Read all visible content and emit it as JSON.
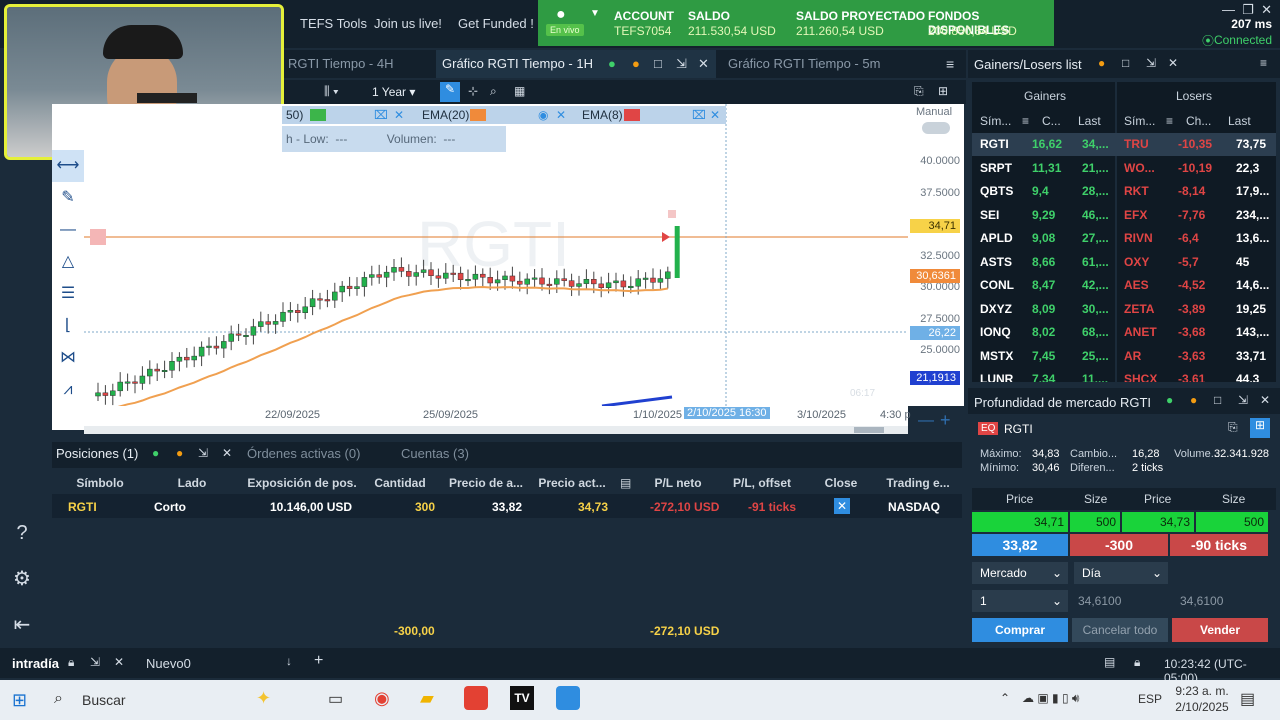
{
  "top_nav": {
    "links": [
      "TEFS Tools",
      "Join us live!",
      "Get Funded !"
    ]
  },
  "account": {
    "account_label": "ACCOUNT",
    "account_value": "TEFS7054",
    "live_badge": "En vivo",
    "saldo_label": "SALDO",
    "saldo_value": "211.530,54 USD",
    "proj_label": "SALDO PROYECTADO",
    "proj_value": "211.260,54 USD",
    "fondos_label": "FONDOS DISPONIBLES",
    "fondos_value": "200.850,54 USD"
  },
  "status": {
    "latency": "207 ms",
    "connection": "Connected"
  },
  "chart_tabs": [
    "RGTI Tiempo - 4H",
    "Gráfico RGTI Tiempo - 1H",
    "Gráfico RGTI Tiempo - 5m"
  ],
  "chart_toolbar": {
    "period": "1 Year"
  },
  "indicators": {
    "ind1": "50)",
    "ema20": "EMA(20)",
    "ema8": "EMA(8)"
  },
  "legend": {
    "low": "h - Low:",
    "low_val": "---",
    "vol": "Volumen:",
    "vol_val": "---"
  },
  "chart": {
    "symbol_watermark": "RGTI",
    "manual_label": "Manual",
    "price_labels": [
      "40.0000",
      "37.5000",
      "32.5000",
      "30.0000",
      "27.5000",
      "25.0000"
    ],
    "tag_last": "34,71",
    "tag_ema": "30,6361",
    "tag_cross": "26,22",
    "tag_low": "21,1913",
    "time_labels": [
      "22/09/2025",
      "25/09/2025",
      "1/10/2025",
      "2/10/2025 16:30",
      "3/10/2025",
      "4:30 p"
    ],
    "faint_time": "06:17"
  },
  "positions": {
    "tabs": [
      "Posiciones (1)",
      "Órdenes activas (0)",
      "Cuentas (3)"
    ],
    "headers": [
      "Símbolo",
      "Lado",
      "Exposición de pos.",
      "Cantidad",
      "Precio de a...",
      "Precio act...",
      "P/L neto",
      "P/L, offset",
      "Close",
      "Trading e..."
    ],
    "row": {
      "symbol": "RGTI",
      "side": "Corto",
      "exposure": "10.146,00 USD",
      "qty": "300",
      "entry": "33,82",
      "current": "34,73",
      "pl_net": "-272,10 USD",
      "pl_offset": "-91 ticks",
      "exchange": "NASDAQ"
    },
    "total_qty": "-300,00",
    "total_pl": "-272,10 USD"
  },
  "gainers_losers": {
    "title": "Gainers/Losers list",
    "gainers_title": "Gainers",
    "losers_title": "Losers",
    "col_sym": "Sím...",
    "col_ch_g": "C...",
    "col_ch_l": "Ch...",
    "col_last": "Last",
    "gainers": [
      {
        "sym": "RGTI",
        "ch": "16,62",
        "last": "34,..."
      },
      {
        "sym": "SRPT",
        "ch": "11,31",
        "last": "21,..."
      },
      {
        "sym": "QBTS",
        "ch": "9,4",
        "last": "28,..."
      },
      {
        "sym": "SEI",
        "ch": "9,29",
        "last": "46,..."
      },
      {
        "sym": "APLD",
        "ch": "9,08",
        "last": "27,..."
      },
      {
        "sym": "ASTS",
        "ch": "8,66",
        "last": "61,..."
      },
      {
        "sym": "CONL",
        "ch": "8,47",
        "last": "42,..."
      },
      {
        "sym": "DXYZ",
        "ch": "8,09",
        "last": "30,..."
      },
      {
        "sym": "IONQ",
        "ch": "8,02",
        "last": "68,..."
      },
      {
        "sym": "MSTX",
        "ch": "7,45",
        "last": "25,..."
      },
      {
        "sym": "LUNR",
        "ch": "7,34",
        "last": "11,..."
      }
    ],
    "losers": [
      {
        "sym": "TRU",
        "ch": "-10,35",
        "last": "73,75"
      },
      {
        "sym": "WO...",
        "ch": "-10,19",
        "last": "22,3"
      },
      {
        "sym": "RKT",
        "ch": "-8,14",
        "last": "17,9..."
      },
      {
        "sym": "EFX",
        "ch": "-7,76",
        "last": "234,..."
      },
      {
        "sym": "RIVN",
        "ch": "-6,4",
        "last": "13,6..."
      },
      {
        "sym": "OXY",
        "ch": "-5,7",
        "last": "45"
      },
      {
        "sym": "AES",
        "ch": "-4,52",
        "last": "14,6..."
      },
      {
        "sym": "ZETA",
        "ch": "-3,89",
        "last": "19,25"
      },
      {
        "sym": "ANET",
        "ch": "-3,68",
        "last": "143,..."
      },
      {
        "sym": "AR",
        "ch": "-3,63",
        "last": "33,71"
      },
      {
        "sym": "SHCX",
        "ch": "-3,61",
        "last": "44,3"
      }
    ]
  },
  "depth": {
    "title": "Profundidad de mercado RGTI",
    "eq": "EQ",
    "symbol": "RGTI",
    "max_label": "Máximo:",
    "max_val": "34,83",
    "min_label": "Mínimo:",
    "min_val": "30,46",
    "cambio_label": "Cambio...",
    "cambio_val": "16,28",
    "difer_label": "Diferen...",
    "difer_val": "2 ticks",
    "vol_label": "Volume...",
    "vol_val": "32.341.928",
    "headers": [
      "Price",
      "Size",
      "Price",
      "Size"
    ],
    "bid_price": "34,71",
    "bid_size": "500",
    "ask_price": "34,73",
    "ask_size": "500",
    "avg_price": "33,82",
    "position": "-300",
    "ticks": "-90 ticks",
    "order_type": "Mercado",
    "tif": "Día",
    "qty": "1",
    "price1": "34,6100",
    "price2": "34,6100",
    "buy": "Comprar",
    "cancel": "Cancelar todo",
    "sell": "Vender"
  },
  "bottom_bar": {
    "workspace1": "intradía",
    "workspace2": "Nuevo0",
    "clock": "10:23:42 (UTC-05:00)"
  },
  "taskbar": {
    "search": "Buscar",
    "lang": "ESP",
    "time": "9:23 a. m.",
    "date": "2/10/2025"
  },
  "colors": {
    "green": "#2f9b43",
    "red": "#e04545",
    "bid": "#19d33a",
    "blue": "#2f8de0"
  }
}
